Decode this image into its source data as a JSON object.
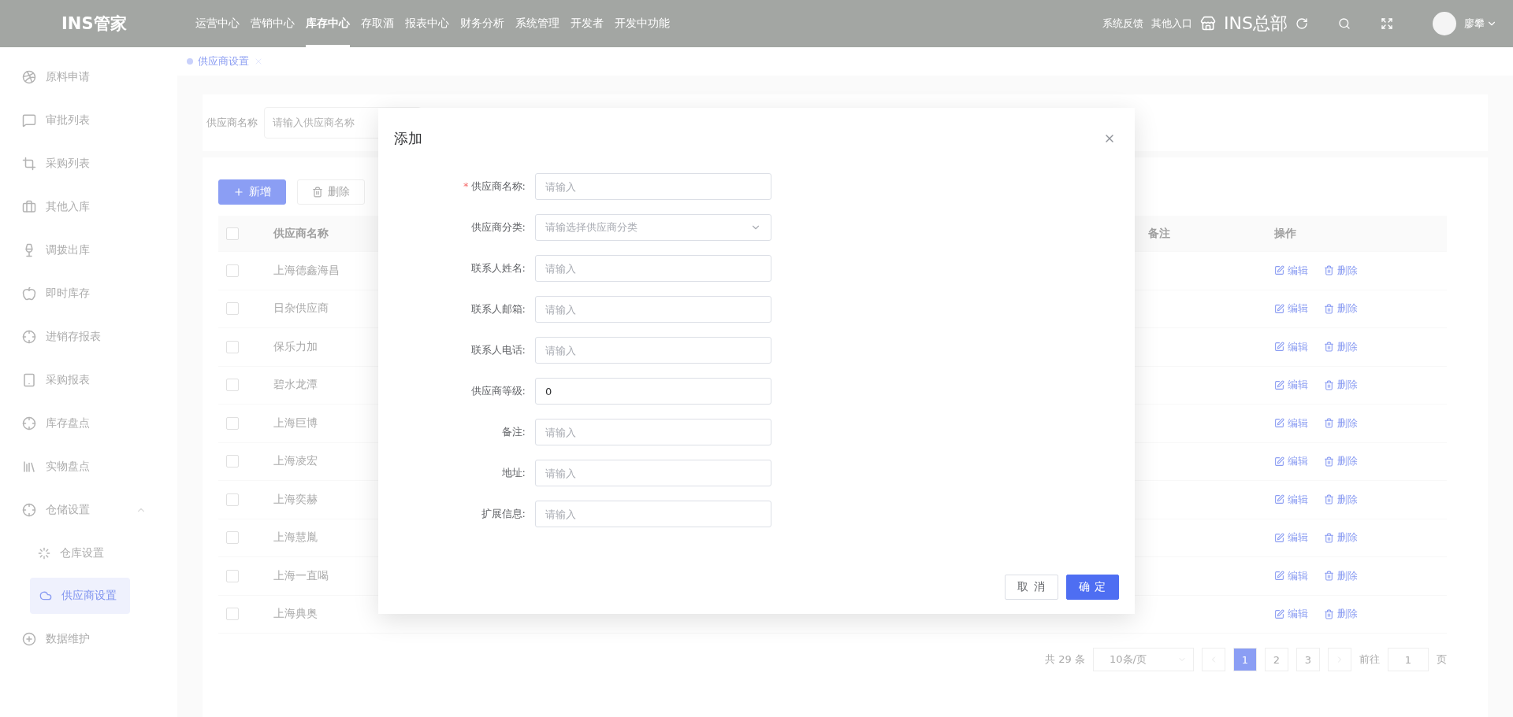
{
  "topbar": {
    "logo": "INS管家",
    "nav": [
      {
        "label": "运营中心",
        "selected": false
      },
      {
        "label": "营销中心",
        "selected": false
      },
      {
        "label": "库存中心",
        "selected": true
      },
      {
        "label": "存取酒",
        "selected": false
      },
      {
        "label": "报表中心",
        "selected": false
      },
      {
        "label": "财务分析",
        "selected": false
      },
      {
        "label": "系统管理",
        "selected": false
      },
      {
        "label": "开发者",
        "selected": false
      },
      {
        "label": "开发中功能",
        "selected": false
      }
    ],
    "links": [
      "系统反馈",
      "其他入口"
    ],
    "store_name": "INS总部",
    "user_name": "廖攀"
  },
  "sidebar": {
    "items": [
      {
        "label": "原料申请",
        "selected": false
      },
      {
        "label": "审批列表",
        "selected": false
      },
      {
        "label": "采购列表",
        "selected": false
      },
      {
        "label": "其他入库",
        "selected": false
      },
      {
        "label": "调拨出库",
        "selected": false
      },
      {
        "label": "即时库存",
        "selected": false
      },
      {
        "label": "进销存报表",
        "selected": false
      },
      {
        "label": "采购报表",
        "selected": false
      },
      {
        "label": "库存盘点",
        "selected": false
      },
      {
        "label": "实物盘点",
        "selected": false
      },
      {
        "label": "仓储设置",
        "selected": false,
        "expanded": true,
        "children": [
          {
            "label": "仓库设置",
            "selected": false
          },
          {
            "label": "供应商设置",
            "selected": true
          }
        ]
      },
      {
        "label": "数据维护",
        "selected": false
      }
    ]
  },
  "tabs": [
    {
      "label": "供应商设置",
      "selected": true
    }
  ],
  "filter": {
    "label": "供应商名称",
    "placeholder": "请输入供应商名称"
  },
  "toolbar": [
    {
      "label": "新增",
      "kind": "primary"
    },
    {
      "label": "删除",
      "kind": "plain"
    }
  ],
  "table": {
    "all_checked": false,
    "columns": [
      "供应商名称",
      "备注",
      "操作"
    ],
    "rows": [
      {
        "name": "上海德鑫海昌",
        "checked": false,
        "actions": [
          "编辑",
          "删除"
        ]
      },
      {
        "name": "日杂供应商",
        "checked": false,
        "actions": [
          "编辑",
          "删除"
        ]
      },
      {
        "name": "保乐力加",
        "checked": false,
        "actions": [
          "编辑",
          "删除"
        ]
      },
      {
        "name": "碧水龙潭",
        "checked": false,
        "actions": [
          "编辑",
          "删除"
        ]
      },
      {
        "name": "上海巨博",
        "checked": false,
        "actions": [
          "编辑",
          "删除"
        ]
      },
      {
        "name": "上海凌宏",
        "checked": false,
        "actions": [
          "编辑",
          "删除"
        ]
      },
      {
        "name": "上海奕赫",
        "checked": false,
        "actions": [
          "编辑",
          "删除"
        ]
      },
      {
        "name": "上海慧胤",
        "checked": false,
        "actions": [
          "编辑",
          "删除"
        ]
      },
      {
        "name": "上海一直喝",
        "checked": false,
        "actions": [
          "编辑",
          "删除"
        ]
      },
      {
        "name": "上海典奥",
        "checked": false,
        "actions": [
          "编辑",
          "删除"
        ]
      }
    ]
  },
  "pagination": {
    "total": "共 29 条",
    "page_size": "10条/页",
    "pages": [
      {
        "label": "1",
        "selected": true
      },
      {
        "label": "2",
        "selected": false
      },
      {
        "label": "3",
        "selected": false
      }
    ],
    "goto_label": "前往",
    "goto_value": "1",
    "page_unit": "页"
  },
  "dialog": {
    "title": "添加",
    "fields": [
      {
        "label": "供应商名称:",
        "required_mark": "*",
        "kind": "input",
        "placeholder": "请输入"
      },
      {
        "label": "供应商分类:",
        "kind": "select",
        "placeholder": "请输选择供应商分类"
      },
      {
        "label": "联系人姓名:",
        "kind": "input",
        "placeholder": "请输入"
      },
      {
        "label": "联系人邮箱:",
        "kind": "input",
        "placeholder": "请输入"
      },
      {
        "label": "联系人电话:",
        "kind": "input",
        "placeholder": "请输入"
      },
      {
        "label": "供应商等级:",
        "kind": "input",
        "value": "0"
      },
      {
        "label": "备注:",
        "kind": "input",
        "placeholder": "请输入"
      },
      {
        "label": "地址:",
        "kind": "input",
        "placeholder": "请输入"
      },
      {
        "label": "扩展信息:",
        "kind": "input",
        "placeholder": "请输入"
      }
    ],
    "buttons": [
      {
        "label": "取 消",
        "kind": "plain"
      },
      {
        "label": "确 定",
        "kind": "primary"
      }
    ]
  }
}
